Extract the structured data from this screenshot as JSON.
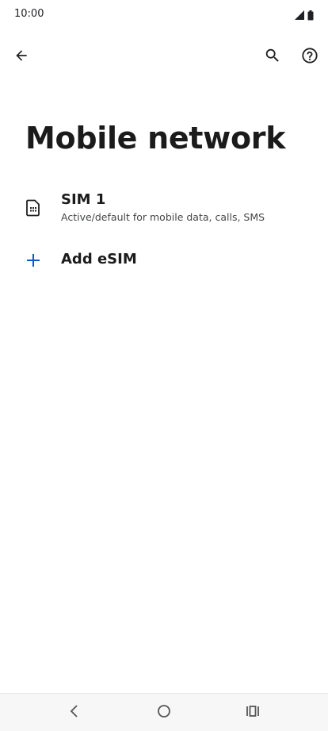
{
  "status_bar": {
    "time": "10:00",
    "icons": [
      "signal-icon",
      "battery-icon"
    ]
  },
  "toolbar": {
    "back_icon": "arrow-left-icon",
    "search_icon": "search-icon",
    "help_icon": "help-circle-icon"
  },
  "page": {
    "title": "Mobile network"
  },
  "items": [
    {
      "icon": "sim-card-icon",
      "title": "SIM 1",
      "subtitle": "Active/default for mobile data, calls, SMS"
    },
    {
      "icon": "plus-icon",
      "title": "Add eSIM"
    }
  ],
  "nav_bar": {
    "icons": [
      "nav-back-icon",
      "nav-home-icon",
      "nav-recents-icon"
    ]
  },
  "colors": {
    "accent": "#0b57d0",
    "text_primary": "#1b1b1b",
    "text_secondary": "#444746",
    "nav_bar_bg": "#f7f7f7"
  }
}
